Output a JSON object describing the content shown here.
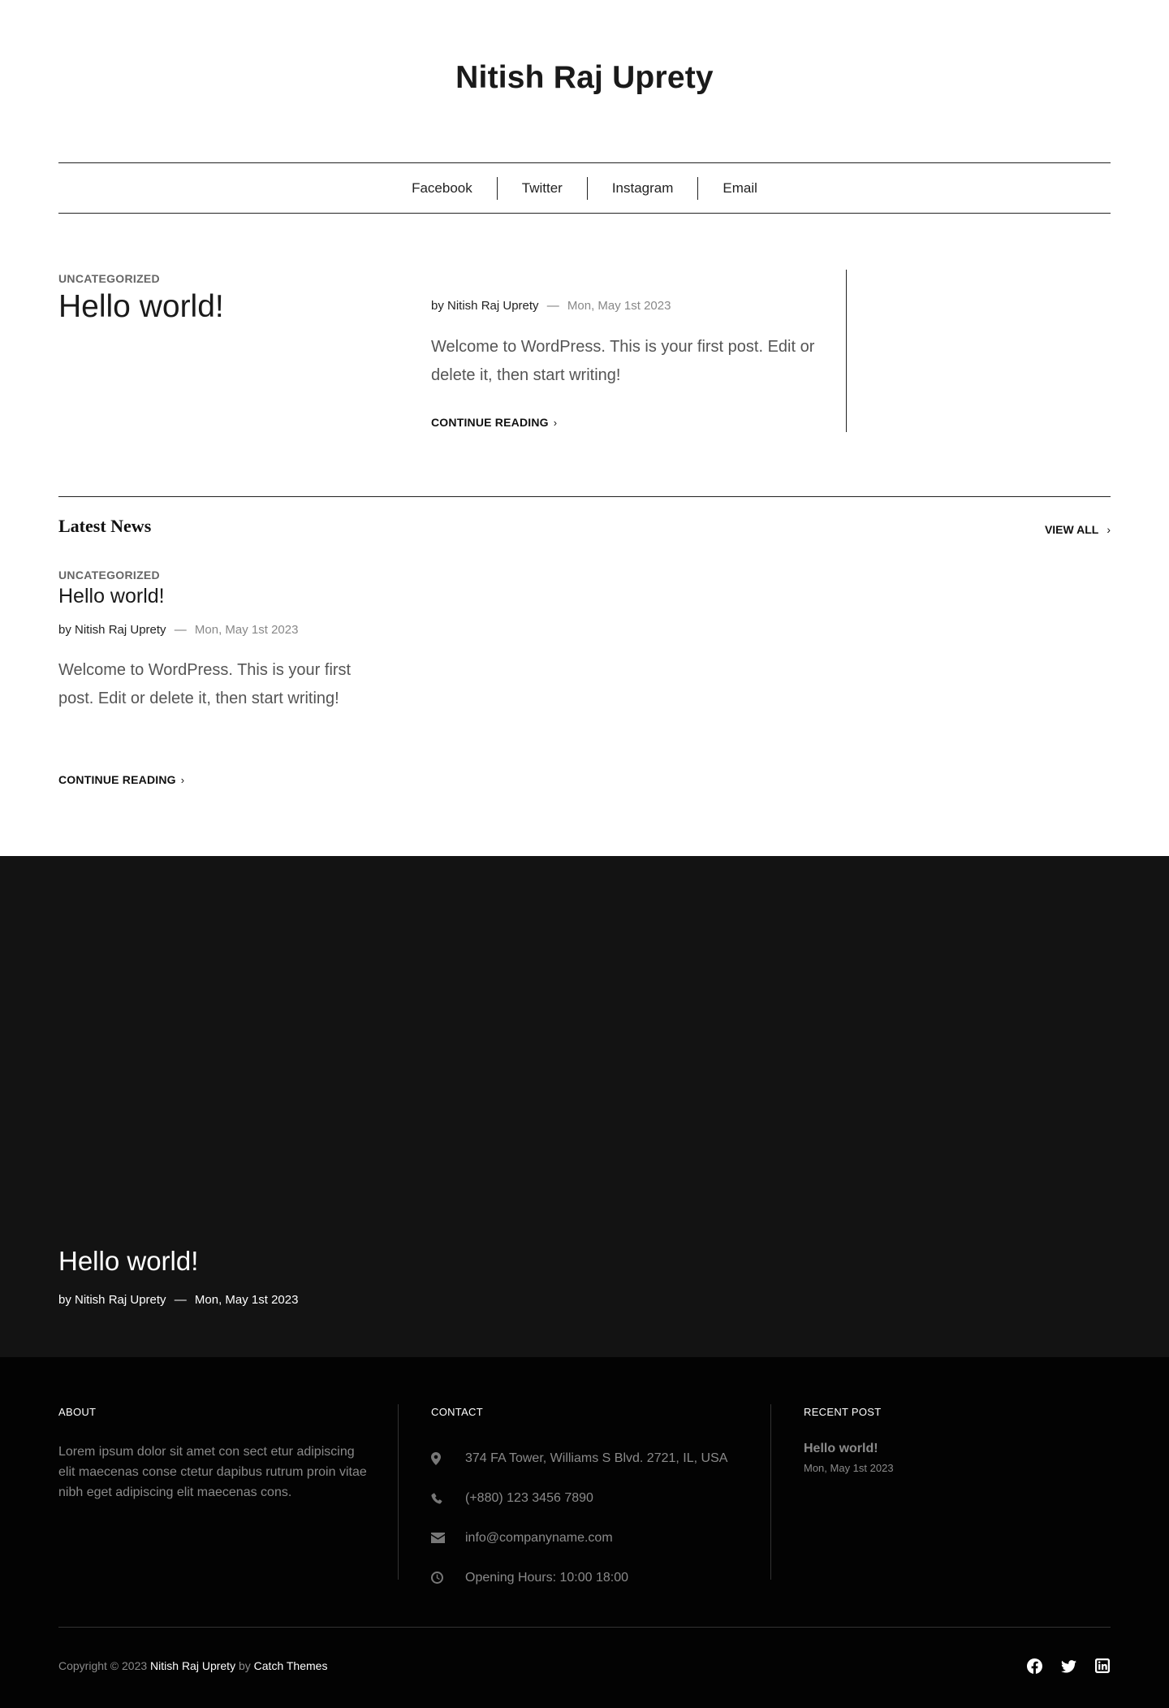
{
  "site": {
    "title": "Nitish Raj Uprety"
  },
  "social_nav": [
    {
      "label": "Facebook"
    },
    {
      "label": "Twitter"
    },
    {
      "label": "Instagram"
    },
    {
      "label": "Email"
    }
  ],
  "featured": {
    "category": "UNCATEGORIZED",
    "title": "Hello world!",
    "by": "by",
    "author": "Nitish Raj Uprety",
    "dash": "—",
    "date": "Mon, May 1st 2023",
    "excerpt": "Welcome to WordPress. This is your first post. Edit or delete it, then start writing!",
    "continue": "CONTINUE READING"
  },
  "latest": {
    "heading": "Latest News",
    "view_all": "VIEW ALL",
    "post": {
      "category": "UNCATEGORIZED",
      "title": "Hello world!",
      "by": "by",
      "author": "Nitish Raj Uprety",
      "dash": "—",
      "date": "Mon, May 1st 2023",
      "excerpt": "Welcome to WordPress. This is your first post. Edit or delete it, then start writing!",
      "continue": "CONTINUE READING"
    }
  },
  "hero": {
    "title": "Hello world!",
    "by": "by",
    "author": "Nitish Raj Uprety",
    "dash": "—",
    "date": "Mon, May 1st 2023"
  },
  "footer": {
    "about": {
      "heading": "ABOUT",
      "text": "Lorem ipsum dolor sit amet con sect etur adipiscing elit maecenas conse ctetur dapibus rutrum proin vitae nibh eget adipiscing elit maecenas cons."
    },
    "contact": {
      "heading": "CONTACT",
      "items": [
        {
          "icon": "map-marker-icon",
          "text": "374 FA Tower, Williams S Blvd. 2721, IL, USA"
        },
        {
          "icon": "phone-icon",
          "text": "(+880) 123 3456 7890"
        },
        {
          "icon": "envelope-icon",
          "text": "info@companyname.com"
        },
        {
          "icon": "clock-icon",
          "text": "Opening Hours: 10:00 18:00"
        }
      ]
    },
    "recent": {
      "heading": "RECENT POST",
      "title": "Hello world!",
      "date": "Mon, May 1st 2023"
    },
    "copyright": {
      "prefix": "Copyright © 2023",
      "site": "Nitish Raj Uprety",
      "by": "by",
      "theme": "Catch Themes"
    },
    "social_icons": [
      "facebook-icon",
      "twitter-icon",
      "linkedin-icon"
    ]
  }
}
